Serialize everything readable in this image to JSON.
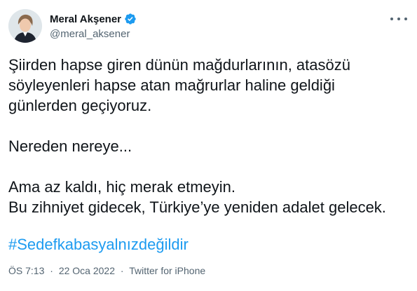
{
  "author": {
    "display_name": "Meral Akşener",
    "handle": "@meral_aksener",
    "verified": true
  },
  "tweet": {
    "paragraphs": [
      [
        "Şiirden hapse giren dünün mağdurlarının, atasözü",
        "söyleyenleri hapse atan mağrurlar haline geldiği",
        "günlerden geçiyoruz."
      ],
      [
        "Nereden nereye..."
      ],
      [
        "Ama az kaldı, hiç merak etmeyin.",
        "Bu zihniyet gidecek, Türkiye’ye yeniden adalet gelecek."
      ]
    ],
    "hashtag": "#Sedefkabasyalnızdeğildir"
  },
  "meta": {
    "time": "ÖS 7:13",
    "separator": "·",
    "date": "22 Oca 2022",
    "source": "Twitter for iPhone"
  },
  "colors": {
    "accent": "#1d9bf0",
    "text": "#0f1419",
    "secondary": "#536471"
  },
  "icons": {
    "verified": "verified-badge-icon",
    "more": "more-options-icon"
  }
}
